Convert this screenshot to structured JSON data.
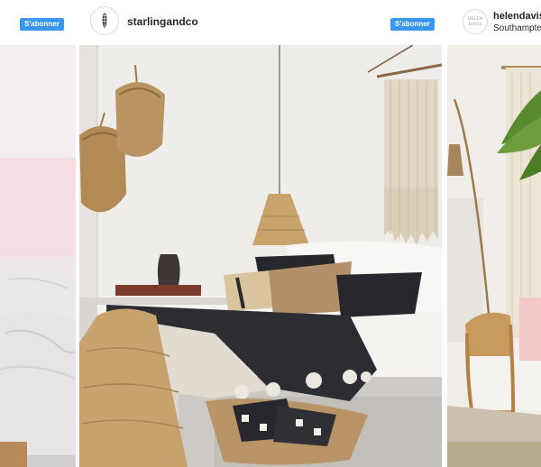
{
  "posts": [
    {
      "follow_label": "S'abonner",
      "photo_alt": "bedroom-photo"
    },
    {
      "username": "starlingandco",
      "follow_label": "S'abonner",
      "photo_alt": "bedroom-photo"
    },
    {
      "username": "helendavis",
      "location": "Southampte",
      "avatar_text": "HELEN DAVIS",
      "photo_alt": "living-room-photo"
    }
  ],
  "colors": {
    "follow_button": "#3897f0",
    "username_text": "#262626",
    "background": "#ffffff"
  }
}
